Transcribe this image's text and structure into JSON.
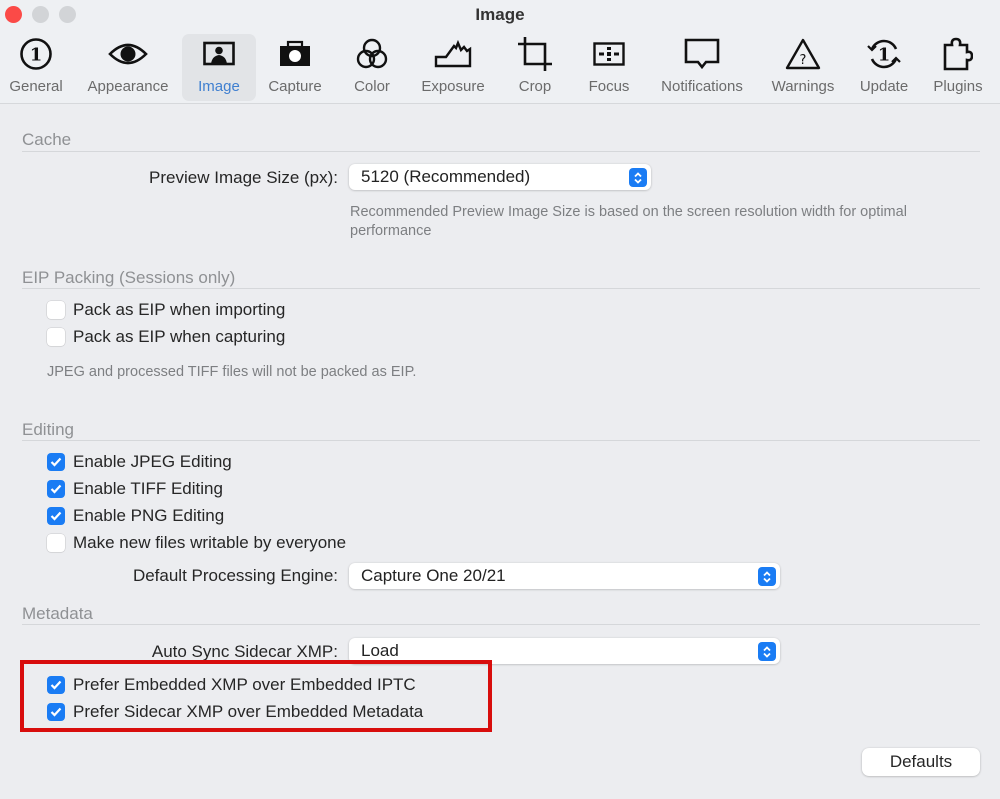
{
  "window": {
    "title": "Image"
  },
  "toolbar": {
    "items": [
      {
        "label": "General",
        "icon": "general-icon",
        "active": false
      },
      {
        "label": "Appearance",
        "icon": "eye-icon",
        "active": false
      },
      {
        "label": "Image",
        "icon": "portrait-image-icon",
        "active": true
      },
      {
        "label": "Capture",
        "icon": "camera-icon",
        "active": false
      },
      {
        "label": "Color",
        "icon": "color-circles-icon",
        "active": false
      },
      {
        "label": "Exposure",
        "icon": "histogram-icon",
        "active": false
      },
      {
        "label": "Crop",
        "icon": "crop-icon",
        "active": false
      },
      {
        "label": "Focus",
        "icon": "focus-icon",
        "active": false
      },
      {
        "label": "Notifications",
        "icon": "speech-bubble-icon",
        "active": false
      },
      {
        "label": "Warnings",
        "icon": "warning-triangle-icon",
        "active": false
      },
      {
        "label": "Update",
        "icon": "update-icon",
        "active": false
      },
      {
        "label": "Plugins",
        "icon": "puzzle-piece-icon",
        "active": false
      }
    ]
  },
  "cache": {
    "title": "Cache",
    "preview_size_label": "Preview Image Size (px):",
    "preview_size_value": "5120 (Recommended)",
    "hint": "Recommended Preview Image Size is based on the screen resolution width for optimal performance"
  },
  "eip": {
    "title": "EIP Packing (Sessions only)",
    "options": [
      {
        "label": "Pack as EIP when importing",
        "checked": false
      },
      {
        "label": "Pack as EIP when capturing",
        "checked": false
      }
    ],
    "hint": "JPEG and processed TIFF files will not be packed as EIP."
  },
  "editing": {
    "title": "Editing",
    "options": [
      {
        "label": "Enable JPEG Editing",
        "checked": true
      },
      {
        "label": "Enable TIFF Editing",
        "checked": true
      },
      {
        "label": "Enable PNG Editing",
        "checked": true
      },
      {
        "label": "Make new files writable by everyone",
        "checked": false
      }
    ],
    "engine_label": "Default Processing Engine:",
    "engine_value": "Capture One 20/21"
  },
  "metadata": {
    "title": "Metadata",
    "sync_label": "Auto Sync Sidecar XMP:",
    "sync_value": "Load",
    "options": [
      {
        "label": "Prefer Embedded XMP over Embedded IPTC",
        "checked": true
      },
      {
        "label": "Prefer Sidecar XMP over Embedded Metadata",
        "checked": true
      }
    ]
  },
  "footer": {
    "defaults_label": "Defaults"
  },
  "colors": {
    "accent": "#1a7cf4",
    "highlight_box": "#d80d0d",
    "active_tab_label": "#3f7fd0"
  }
}
